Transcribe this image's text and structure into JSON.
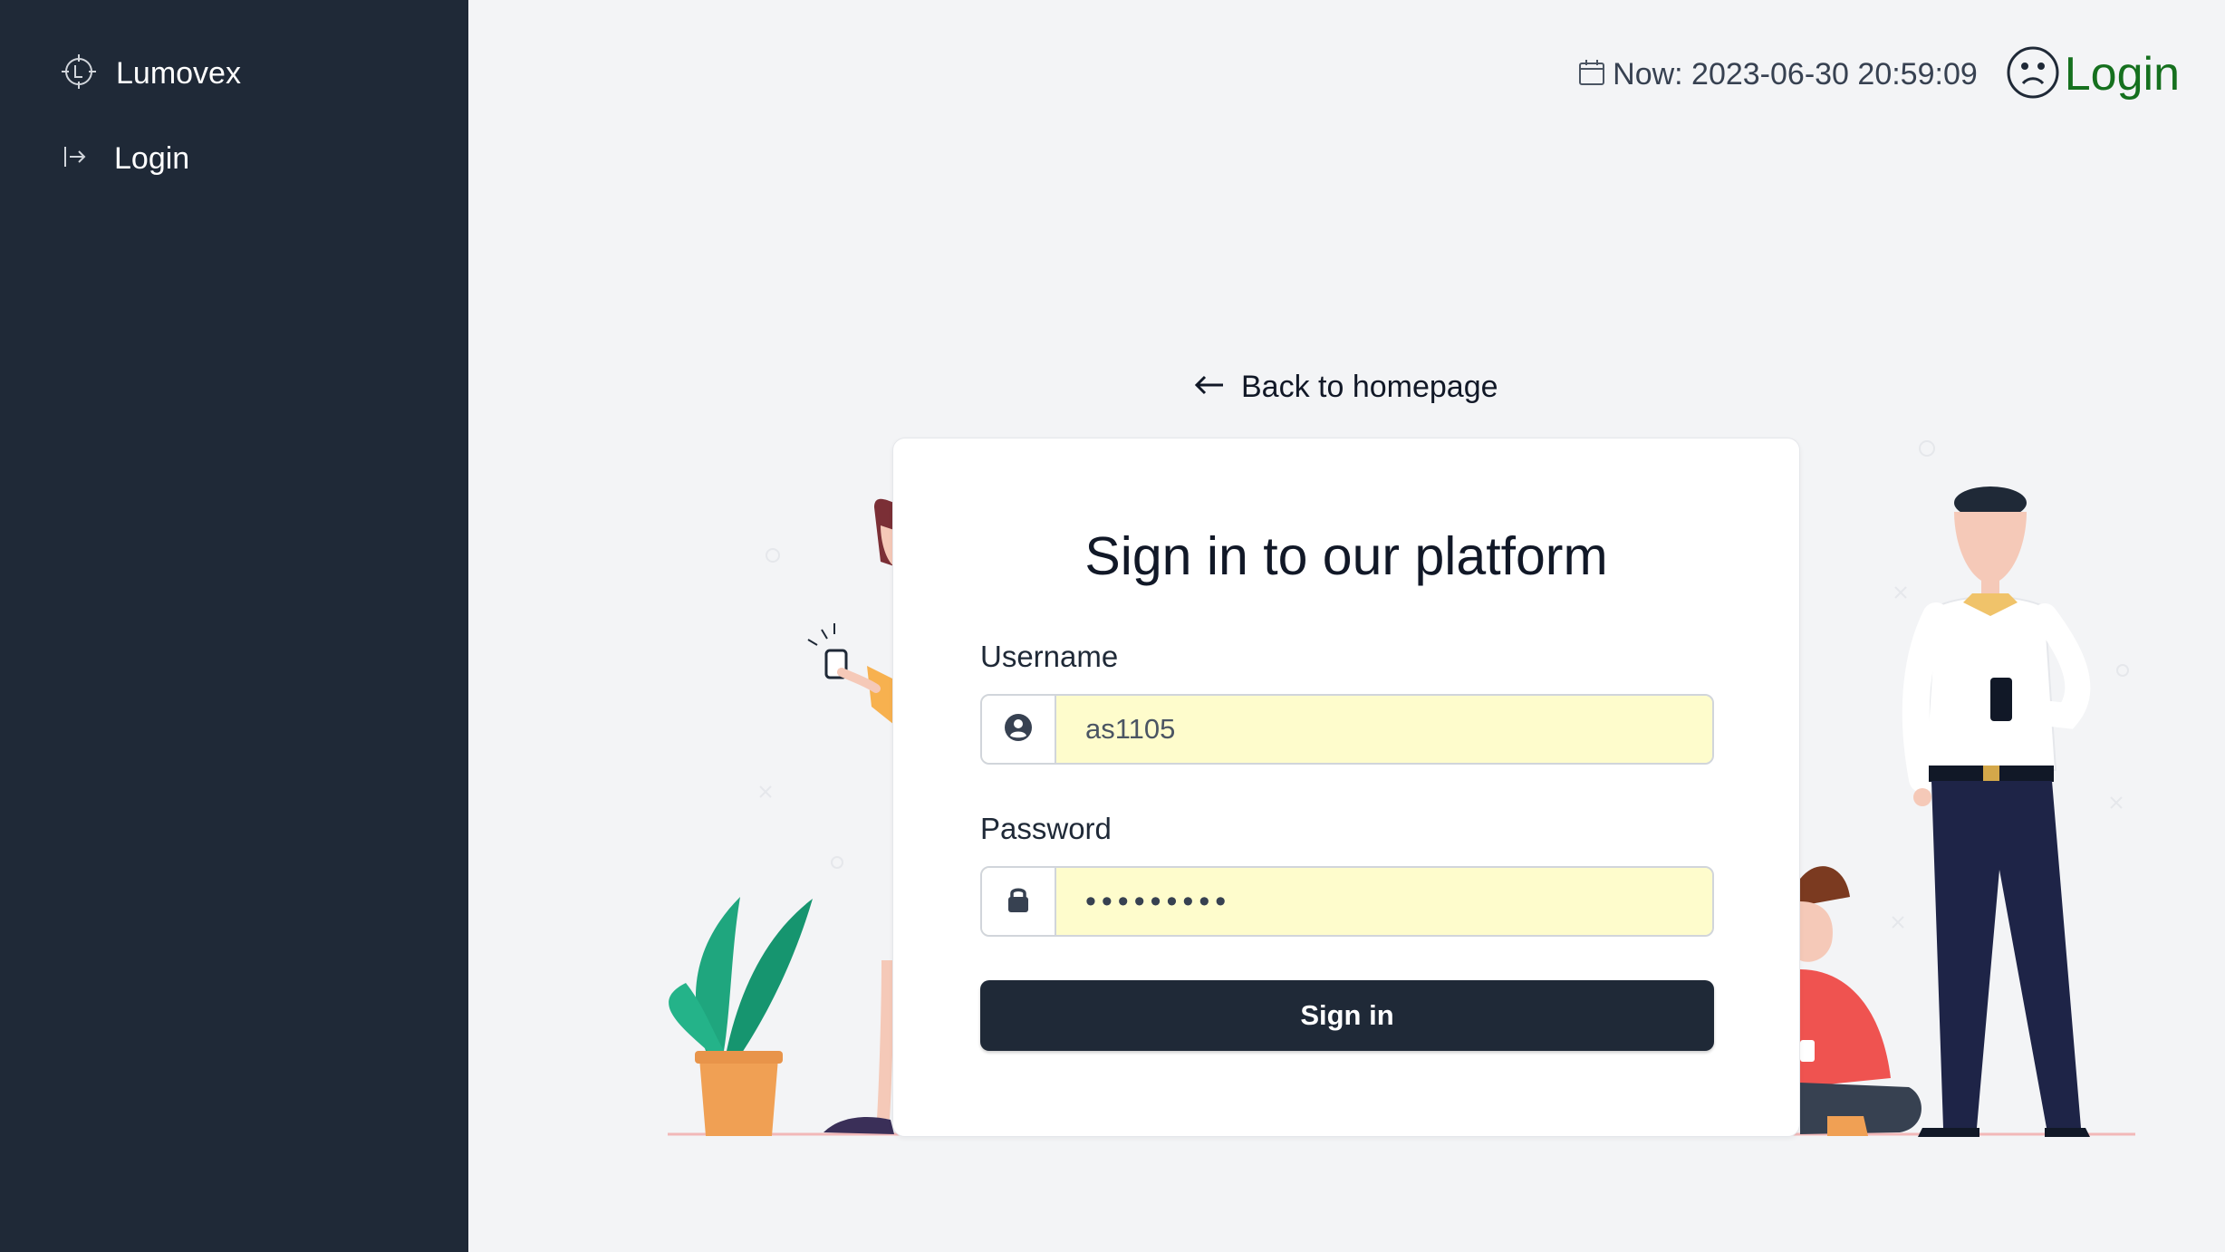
{
  "sidebar": {
    "brand": {
      "label": "Lumovex",
      "icon": "crosshair-logo-icon"
    },
    "items": [
      {
        "label": "Login",
        "icon": "sign-in-icon"
      }
    ]
  },
  "header": {
    "datetime": "Now: 2023-06-30 20:59:09",
    "datetime_icon": "calendar-icon",
    "login_label": "Login",
    "login_icon": "sad-face-icon"
  },
  "back_link": {
    "label": "Back to homepage",
    "icon": "arrow-left-icon"
  },
  "login_form": {
    "title": "Sign in to our platform",
    "username": {
      "label": "Username",
      "value": "as1105",
      "icon": "user-circle-icon"
    },
    "password": {
      "label": "Password",
      "value": "123456789",
      "icon": "lock-icon"
    },
    "submit_label": "Sign in"
  },
  "colors": {
    "sidebar_bg": "#1f2937",
    "page_bg": "#f3f4f6",
    "login_link": "#15701e",
    "autofill_bg": "#fefccc",
    "button_bg": "#1f2937"
  }
}
